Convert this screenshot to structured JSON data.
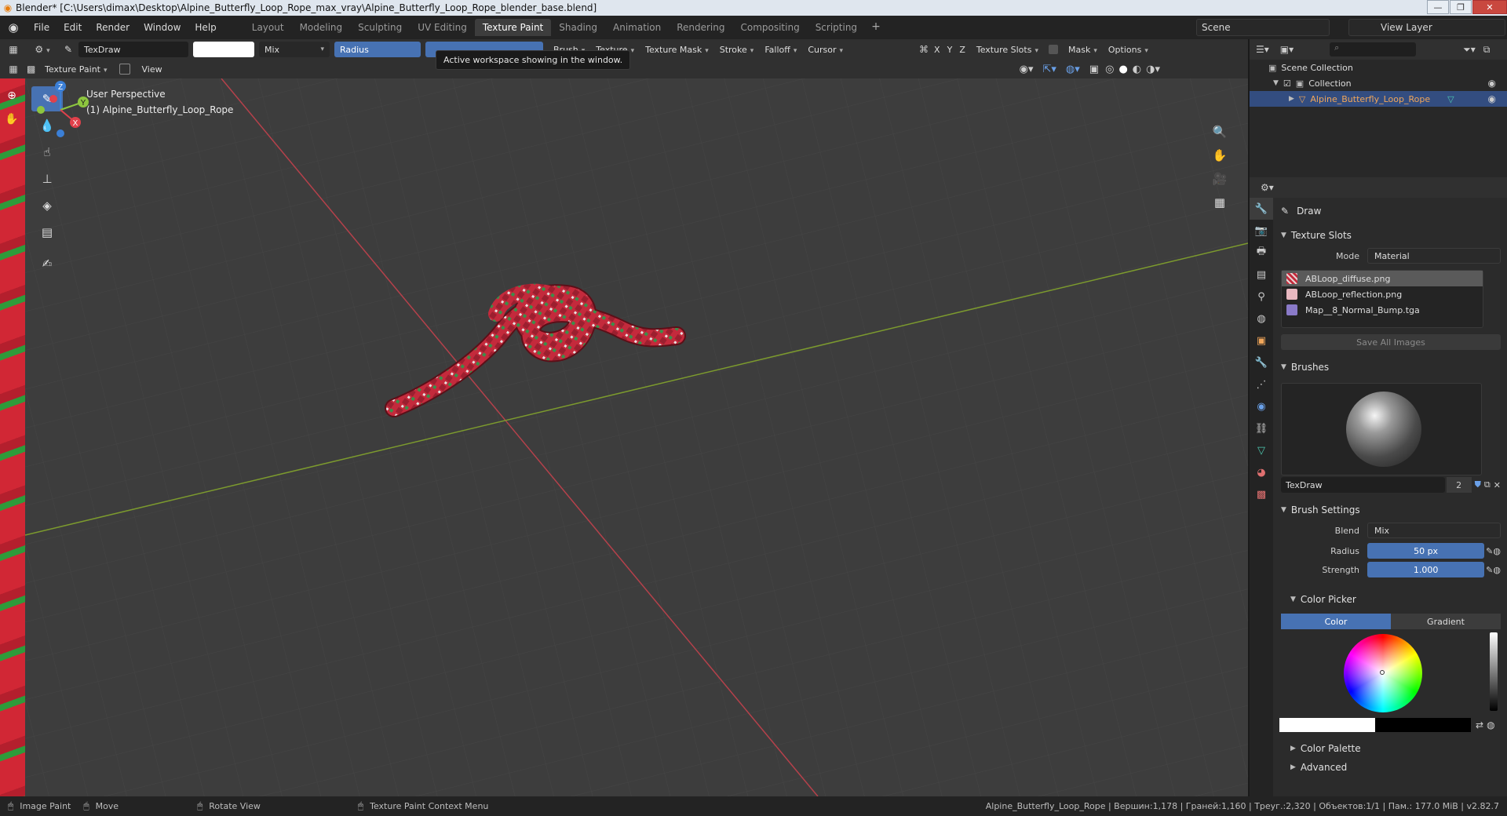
{
  "window": {
    "title": "Blender* [C:\\Users\\dimax\\Desktop\\Alpine_Butterfly_Loop_Rope_max_vray\\Alpine_Butterfly_Loop_Rope_blender_base.blend]"
  },
  "menus": [
    "File",
    "Edit",
    "Render",
    "Window",
    "Help"
  ],
  "workspaces": [
    "Layout",
    "Modeling",
    "Sculpting",
    "UV Editing",
    "Texture Paint",
    "Shading",
    "Animation",
    "Rendering",
    "Compositing",
    "Scripting"
  ],
  "active_workspace": "Texture Paint",
  "scene": "Scene",
  "view_layer": "View Layer",
  "tool_header": {
    "brush_name": "TexDraw",
    "blend": "Mix",
    "radius_label": "Radius",
    "menus": [
      "Brush",
      "Texture",
      "Texture Mask",
      "Stroke",
      "Falloff",
      "Cursor"
    ],
    "axis": [
      "X",
      "Y",
      "Z"
    ],
    "texture_slots": "Texture Slots",
    "mask": "Mask",
    "options": "Options"
  },
  "mode_header": {
    "mode": "Texture Paint",
    "view": "View"
  },
  "tooltip": "Active workspace showing in the window.",
  "viewport": {
    "perspective": "User Perspective",
    "object": "(1) Alpine_Butterfly_Loop_Rope",
    "gizmo": {
      "x": "X",
      "y": "Y",
      "z": "Z"
    }
  },
  "outliner": {
    "scene_collection": "Scene Collection",
    "collection": "Collection",
    "object": "Alpine_Butterfly_Loop_Rope"
  },
  "properties": {
    "tool_name": "Draw",
    "texture_slots": {
      "title": "Texture Slots",
      "mode_label": "Mode",
      "mode": "Material",
      "slots": [
        "ABLoop_diffuse.png",
        "ABLoop_reflection.png",
        "Map__8_Normal_Bump.tga"
      ],
      "save_all": "Save All Images"
    },
    "brushes": {
      "title": "Brushes",
      "name": "TexDraw",
      "users": "2"
    },
    "brush_settings": {
      "title": "Brush Settings",
      "blend_label": "Blend",
      "blend": "Mix",
      "radius_label": "Radius",
      "radius": "50 px",
      "strength_label": "Strength",
      "strength": "1.000"
    },
    "color_picker": {
      "title": "Color Picker",
      "tab_color": "Color",
      "tab_gradient": "Gradient"
    },
    "color_palette": "Color Palette",
    "advanced": "Advanced"
  },
  "statusbar": {
    "items": [
      "Image Paint",
      "Move",
      "Rotate View",
      "Texture Paint Context Menu"
    ],
    "stats": "Alpine_Butterfly_Loop_Rope | Вершин:1,178 | Граней:1,160 | Треуг.:2,320 | Объектов:1/1 | Пам.: 177.0 MiB | v2.82.7"
  },
  "colors": {
    "accent": "#4772b3",
    "rope_red": "#c42a3c",
    "rope_green": "#3b8f4a",
    "viewport_bg": "#3d3d3d"
  }
}
